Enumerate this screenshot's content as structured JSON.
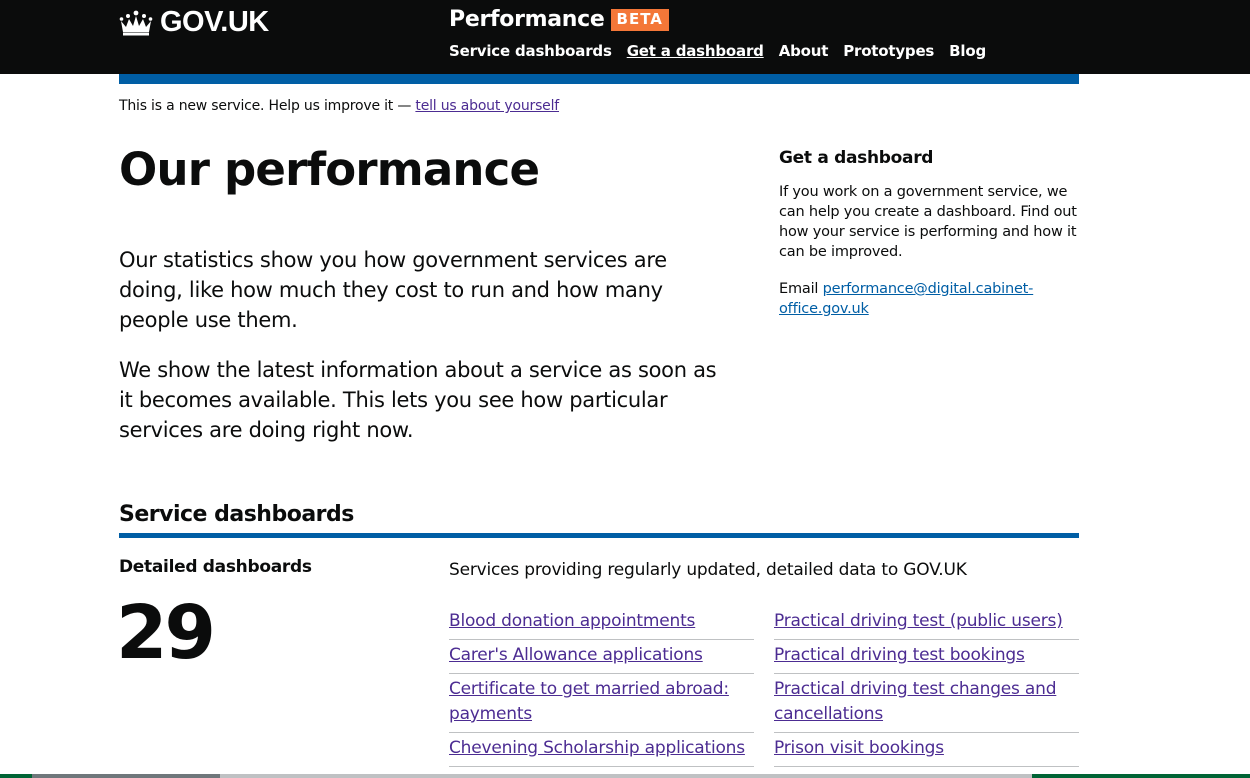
{
  "header": {
    "logo_text": "GOV.UK",
    "product_name": "Performance",
    "phase_tag": "BETA",
    "nav": [
      {
        "label": "Service dashboards",
        "active": false
      },
      {
        "label": "Get a dashboard",
        "active": true
      },
      {
        "label": "About",
        "active": false
      },
      {
        "label": "Prototypes",
        "active": false
      },
      {
        "label": "Blog",
        "active": false
      }
    ]
  },
  "banner": {
    "text": "This is a new service. Help us improve it — ",
    "link": "tell us about yourself"
  },
  "main": {
    "title": "Our performance",
    "lead1": "Our statistics show you how government services are doing, like how much they cost to run and how many people use them.",
    "lead2": "We show the latest information about a service as soon as it becomes available. This lets you see how particular services are doing right now."
  },
  "aside": {
    "title": "Get a dashboard",
    "body": "If you work on a government service, we can help you create a dashboard. Find out how your service is performing and how it can be improved.",
    "email_label": "Email ",
    "email_link": "performance@digital.cabinet-office.gov.uk"
  },
  "dashboards": {
    "section_title": "Service dashboards",
    "detailed_label": "Detailed dashboards",
    "count": "29",
    "intro": "Services providing regularly updated, detailed data to GOV.UK",
    "left_services": [
      "Blood donation appointments",
      "Carer's Allowance applications",
      "Certificate to get married abroad: payments",
      "Chevening Scholarship applications"
    ],
    "right_services": [
      "Practical driving test (public users)",
      "Practical driving test bookings",
      "Practical driving test changes and cancellations",
      "Prison visit bookings"
    ]
  },
  "colors": {
    "header_bg": "#0b0c0c",
    "accent_blue": "#005ea5",
    "phase_tag": "#f47738",
    "link": "#4c2c92"
  },
  "icons": {
    "logo": "crown-icon"
  }
}
